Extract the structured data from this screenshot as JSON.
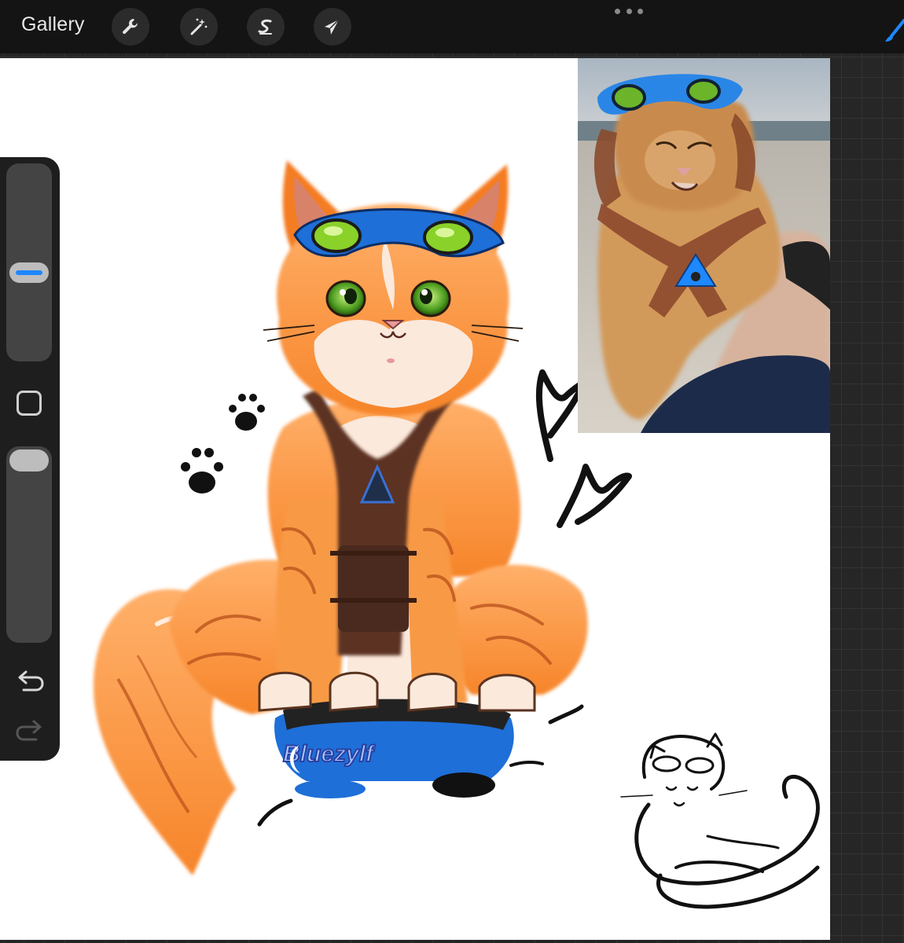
{
  "toolbar": {
    "gallery_label": "Gallery",
    "tools": [
      "wrench-icon",
      "magic-wand-icon",
      "selection-s-icon",
      "transform-arrow-icon"
    ],
    "accent_color": "#1e88ff"
  },
  "sidebar": {
    "brush_size_level": 0.55,
    "brush_opacity_level": 0.93
  },
  "canvas": {
    "watermark_text": "Bluezylf"
  }
}
